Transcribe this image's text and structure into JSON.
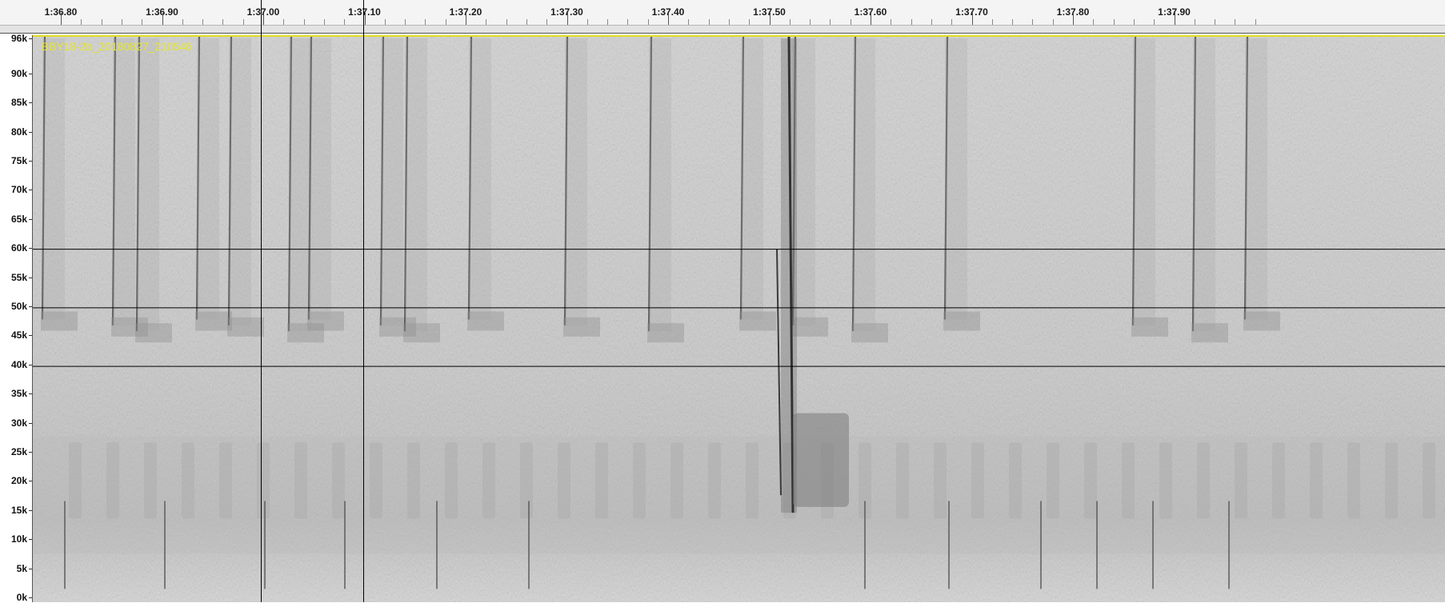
{
  "time_ruler": {
    "labels": [
      "1:36.80",
      "1:36.90",
      "1:37.00",
      "1:37.10",
      "1:37.20",
      "1:37.30",
      "1:37.40",
      "1:37.50",
      "1:37.60",
      "1:37.70",
      "1:37.80",
      "1:37.90"
    ]
  },
  "freq_axis": {
    "labels": [
      "96k",
      "90k",
      "85k",
      "80k",
      "75k",
      "70k",
      "65k",
      "60k",
      "55k",
      "50k",
      "45k",
      "40k",
      "35k",
      "30k",
      "25k",
      "20k",
      "15k",
      "10k",
      "5k",
      "0k"
    ],
    "values_khz": [
      96,
      90,
      85,
      80,
      75,
      70,
      65,
      60,
      55,
      50,
      45,
      40,
      35,
      30,
      25,
      20,
      15,
      10,
      5,
      0
    ],
    "max_khz": 96
  },
  "spectrogram": {
    "file_name": "BBY18-2b_20180827_210546",
    "reference_lines_khz": [
      60,
      50,
      40
    ],
    "selection_times": [
      "1:37.00",
      "1:37.10"
    ]
  },
  "colors": {
    "background": "#cfcfcf",
    "label": "#e6e62a"
  }
}
